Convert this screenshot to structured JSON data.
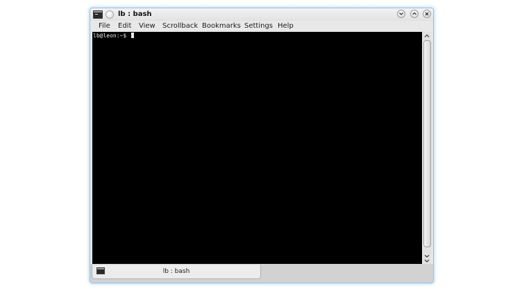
{
  "window": {
    "title": "lb : bash",
    "icons": {
      "app": "terminal-icon",
      "pin": "pin-icon",
      "minimize": "chevron-down-icon",
      "maximize": "chevron-up-icon",
      "close": "close-icon"
    }
  },
  "menubar": {
    "items": [
      "File",
      "Edit",
      "View",
      "Scrollback",
      "Bookmarks",
      "Settings",
      "Help"
    ]
  },
  "terminal": {
    "prompt": "lb@leon:~$ ",
    "background": "#000000",
    "foreground": "#e8e8e8"
  },
  "scrollbar": {
    "up_icon": "chevron-up-icon",
    "down_icon": "chevron-down-icon"
  },
  "tabs": [
    {
      "label": "lb : bash",
      "icon": "terminal-icon"
    }
  ],
  "colors": {
    "window_border": "#93c4ea",
    "chrome": "#e6e6e6"
  }
}
